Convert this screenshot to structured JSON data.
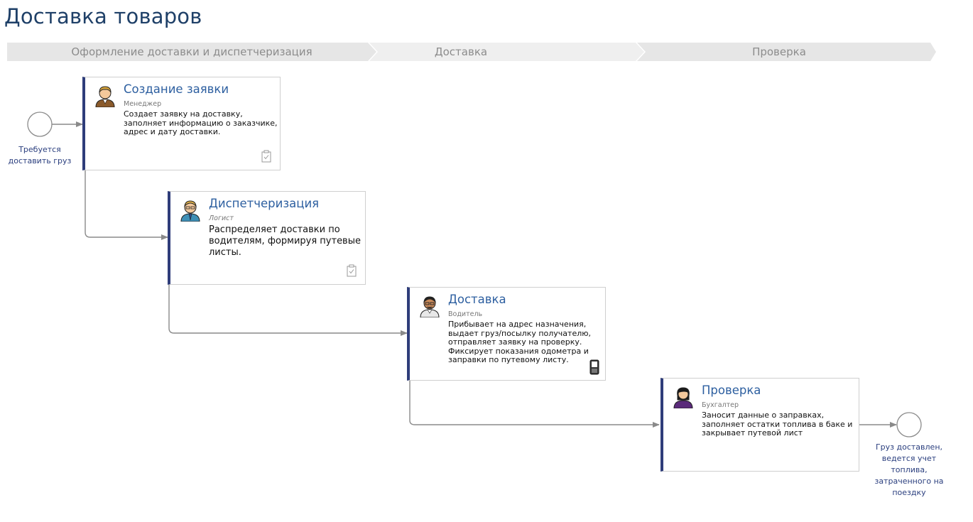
{
  "page": {
    "title": "Доставка товаров"
  },
  "phases": [
    {
      "label": "Оформление доставки и диспетчеризация"
    },
    {
      "label": "Доставка"
    },
    {
      "label": "Проверка"
    }
  ],
  "start_event": {
    "label": "Требуется доставить груз"
  },
  "end_event": {
    "label": "Груз доставлен, ведется учет топлива, затраченного на поездку"
  },
  "tasks": [
    {
      "title": "Создание заявки",
      "role": "Менеджер",
      "description": "Создает заявку на доставку, заполняет информацию о заказчике, адрес и дату доставки.",
      "badge_icon": "clipboard-check-icon",
      "avatar_icon": "manager-avatar-icon"
    },
    {
      "title": "Диспетчеризация",
      "role": "Логист",
      "description": "Распределяет доставки по водителям, формируя путевые листы.",
      "badge_icon": "clipboard-check-icon",
      "avatar_icon": "logist-avatar-icon"
    },
    {
      "title": "Доставка",
      "role": "Водитель",
      "description": "Прибывает на адрес назначения, выдает груз/посылку получателю, отправляет заявку на проверку. Фиксирует показания одометра и заправки по путевому листу.",
      "badge_icon": "mobile-phone-icon",
      "avatar_icon": "driver-avatar-icon"
    },
    {
      "title": "Проверка",
      "role": "Бухгалтер",
      "description": "Заносит данные о заправках, заполняет остатки топлива в баке и закрывает путевой лист",
      "badge_icon": "",
      "avatar_icon": "accountant-avatar-icon"
    }
  ],
  "colors": {
    "title": "#1f4068",
    "task_title": "#2d5fa0",
    "card_accent": "#2f3d7a",
    "phase_band": "#e6e6e6",
    "event_label": "#2a3e7e",
    "connector": "#8a8a8a"
  }
}
